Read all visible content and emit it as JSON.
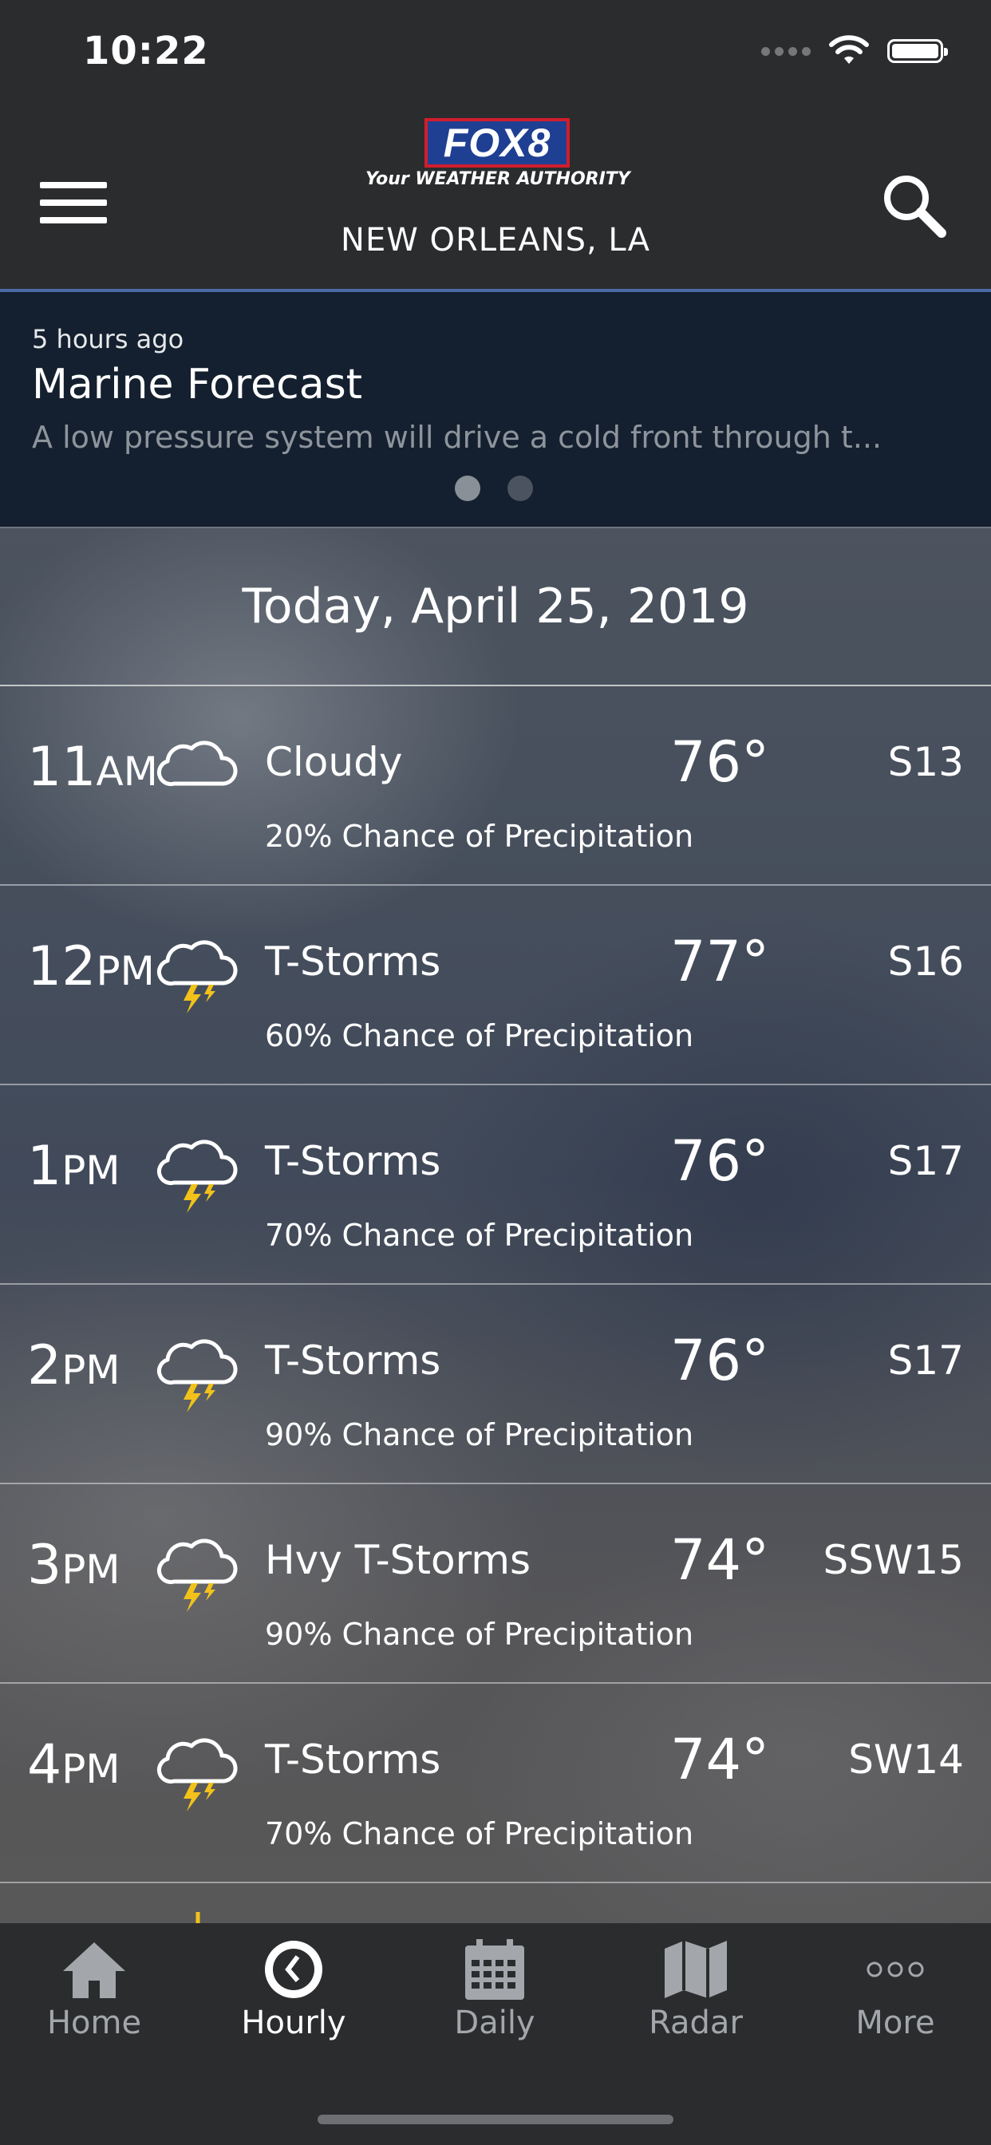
{
  "status_bar": {
    "time": "10:22"
  },
  "header": {
    "logo_text": "FOX8",
    "logo_tagline": "Your WEATHER AUTHORITY",
    "location": "NEW ORLEANS, LA"
  },
  "news": {
    "time_ago": "5 hours ago",
    "title": "Marine Forecast",
    "body": "A low pressure system will drive a cold front through t...",
    "page_count": 2,
    "active_page": 1
  },
  "date_header": "Today, April 25, 2019",
  "hourly": [
    {
      "hour": "11",
      "ampm": "AM",
      "icon": "cloud-icon",
      "condition": "Cloudy",
      "temp": "76°",
      "wind": "S13",
      "precip": "20% Chance of Precipitation"
    },
    {
      "hour": "12",
      "ampm": "PM",
      "icon": "thunderstorm-icon",
      "condition": "T-Storms",
      "temp": "77°",
      "wind": "S16",
      "precip": "60% Chance of Precipitation"
    },
    {
      "hour": "1",
      "ampm": "PM",
      "icon": "thunderstorm-icon",
      "condition": "T-Storms",
      "temp": "76°",
      "wind": "S17",
      "precip": "70% Chance of Precipitation"
    },
    {
      "hour": "2",
      "ampm": "PM",
      "icon": "thunderstorm-icon",
      "condition": "T-Storms",
      "temp": "76°",
      "wind": "S17",
      "precip": "90% Chance of Precipitation"
    },
    {
      "hour": "3",
      "ampm": "PM",
      "icon": "thunderstorm-icon",
      "condition": "Hvy T-Storms",
      "temp": "74°",
      "wind": "SSW15",
      "precip": "90% Chance of Precipitation"
    },
    {
      "hour": "4",
      "ampm": "PM",
      "icon": "thunderstorm-icon",
      "condition": "T-Storms",
      "temp": "74°",
      "wind": "SW14",
      "precip": "70% Chance of Precipitation"
    }
  ],
  "tabs": [
    {
      "label": "Home",
      "icon": "home-icon",
      "active": false
    },
    {
      "label": "Hourly",
      "icon": "clock-icon",
      "active": true
    },
    {
      "label": "Daily",
      "icon": "calendar-icon",
      "active": false
    },
    {
      "label": "Radar",
      "icon": "map-icon",
      "active": false
    },
    {
      "label": "More",
      "icon": "more-icon",
      "active": false
    }
  ],
  "colors": {
    "topbar_bg": "#2b2c2e",
    "news_bg": "#14202f",
    "accent_line": "#4b6aa8",
    "bolt": "#f2c21b",
    "logo_blue": "#1f3f93",
    "logo_red": "#d21d2b"
  }
}
